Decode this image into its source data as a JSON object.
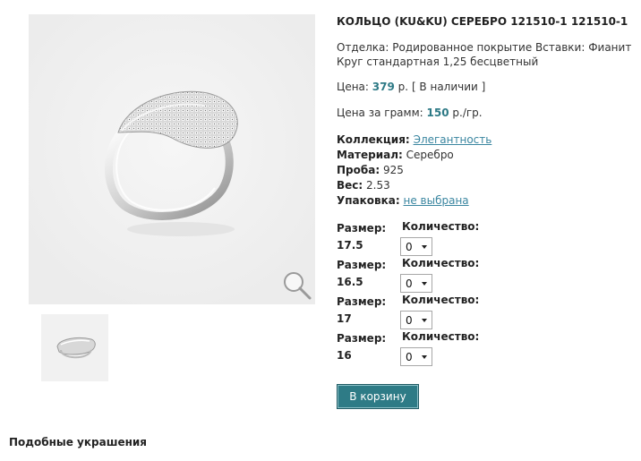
{
  "product": {
    "title": "КОЛЬЦО (KU&KU) СЕРЕБРО 121510-1 121510-1",
    "description": "Отделка: Родированное покрытие Вставки: Фианит Круг стандартная 1,25 бесцветный"
  },
  "price": {
    "label": "Цена:",
    "value": "379",
    "currency": "р.",
    "availability": "[ В наличии ]"
  },
  "gram_price": {
    "label": "Цена за грамм:",
    "value": "150",
    "unit": "р./гр."
  },
  "props": {
    "collection_label": "Коллекция:",
    "collection_value": "Элегантность",
    "material_label": "Материал:",
    "material_value": "Серебро",
    "probe_label": "Проба:",
    "probe_value": "925",
    "weight_label": "Вес:",
    "weight_value": "2.53",
    "package_label": "Упаковка:",
    "package_value": "не выбрана"
  },
  "sizes": [
    {
      "label": "Размер:",
      "size": "17.5",
      "qty_label": "Количество:",
      "qty": "0"
    },
    {
      "label": "Размер:",
      "size": "16.5",
      "qty_label": "Количество:",
      "qty": "0"
    },
    {
      "label": "Размер:",
      "size": "17",
      "qty_label": "Количество:",
      "qty": "0"
    },
    {
      "label": "Размер:",
      "size": "16",
      "qty_label": "Количество:",
      "qty": "0"
    }
  ],
  "cart_button": "В корзину",
  "similar_heading": "Подобные украшения",
  "icons": {
    "zoom": "magnifier-icon"
  }
}
